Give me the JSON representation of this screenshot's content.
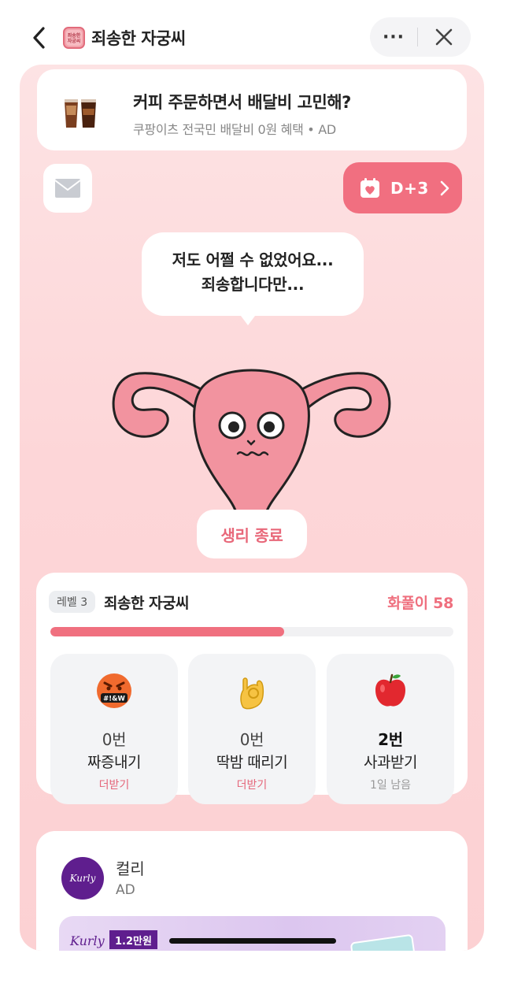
{
  "header": {
    "title": "죄송한 자궁씨",
    "app_icon_text": "죄송한 자궁씨",
    "more_label": "···"
  },
  "ad_banner": {
    "title": "커피 주문하면서 배달비 고민해?",
    "subtitle": "쿠팡이츠 전국민 배달비 0원 혜택 • AD"
  },
  "dday": {
    "label": "D+3"
  },
  "speech": {
    "line1": "저도 어쩔 수 없었어요...",
    "line2": "죄송합니다만..."
  },
  "end_button": {
    "label": "생리 종료"
  },
  "level": {
    "badge": "레벨 3",
    "name": "죄송한 자궁씨",
    "score_label": "화풀이 58",
    "progress_fraction": 0.58
  },
  "stats": [
    {
      "icon": "angry-face-icon",
      "count": "0번",
      "label": "짜증내기",
      "sub": "더받기",
      "emoji_text": "#!&W"
    },
    {
      "icon": "flick-hand-icon",
      "count": "0번",
      "label": "딱밤 때리기",
      "sub": "더받기"
    },
    {
      "icon": "apple-icon",
      "count": "2번",
      "label": "사과받기",
      "sub": "1일 남음"
    }
  ],
  "kurly_ad": {
    "name": "컬리",
    "ad_label": "AD",
    "logo_text": "Kurly",
    "banner_logo": "Kurly",
    "banner_price": "1.2만원"
  },
  "colors": {
    "accent_pink": "#f16f80",
    "background_pink": "#fde3e4",
    "kurly_purple": "#5f1e8e"
  }
}
